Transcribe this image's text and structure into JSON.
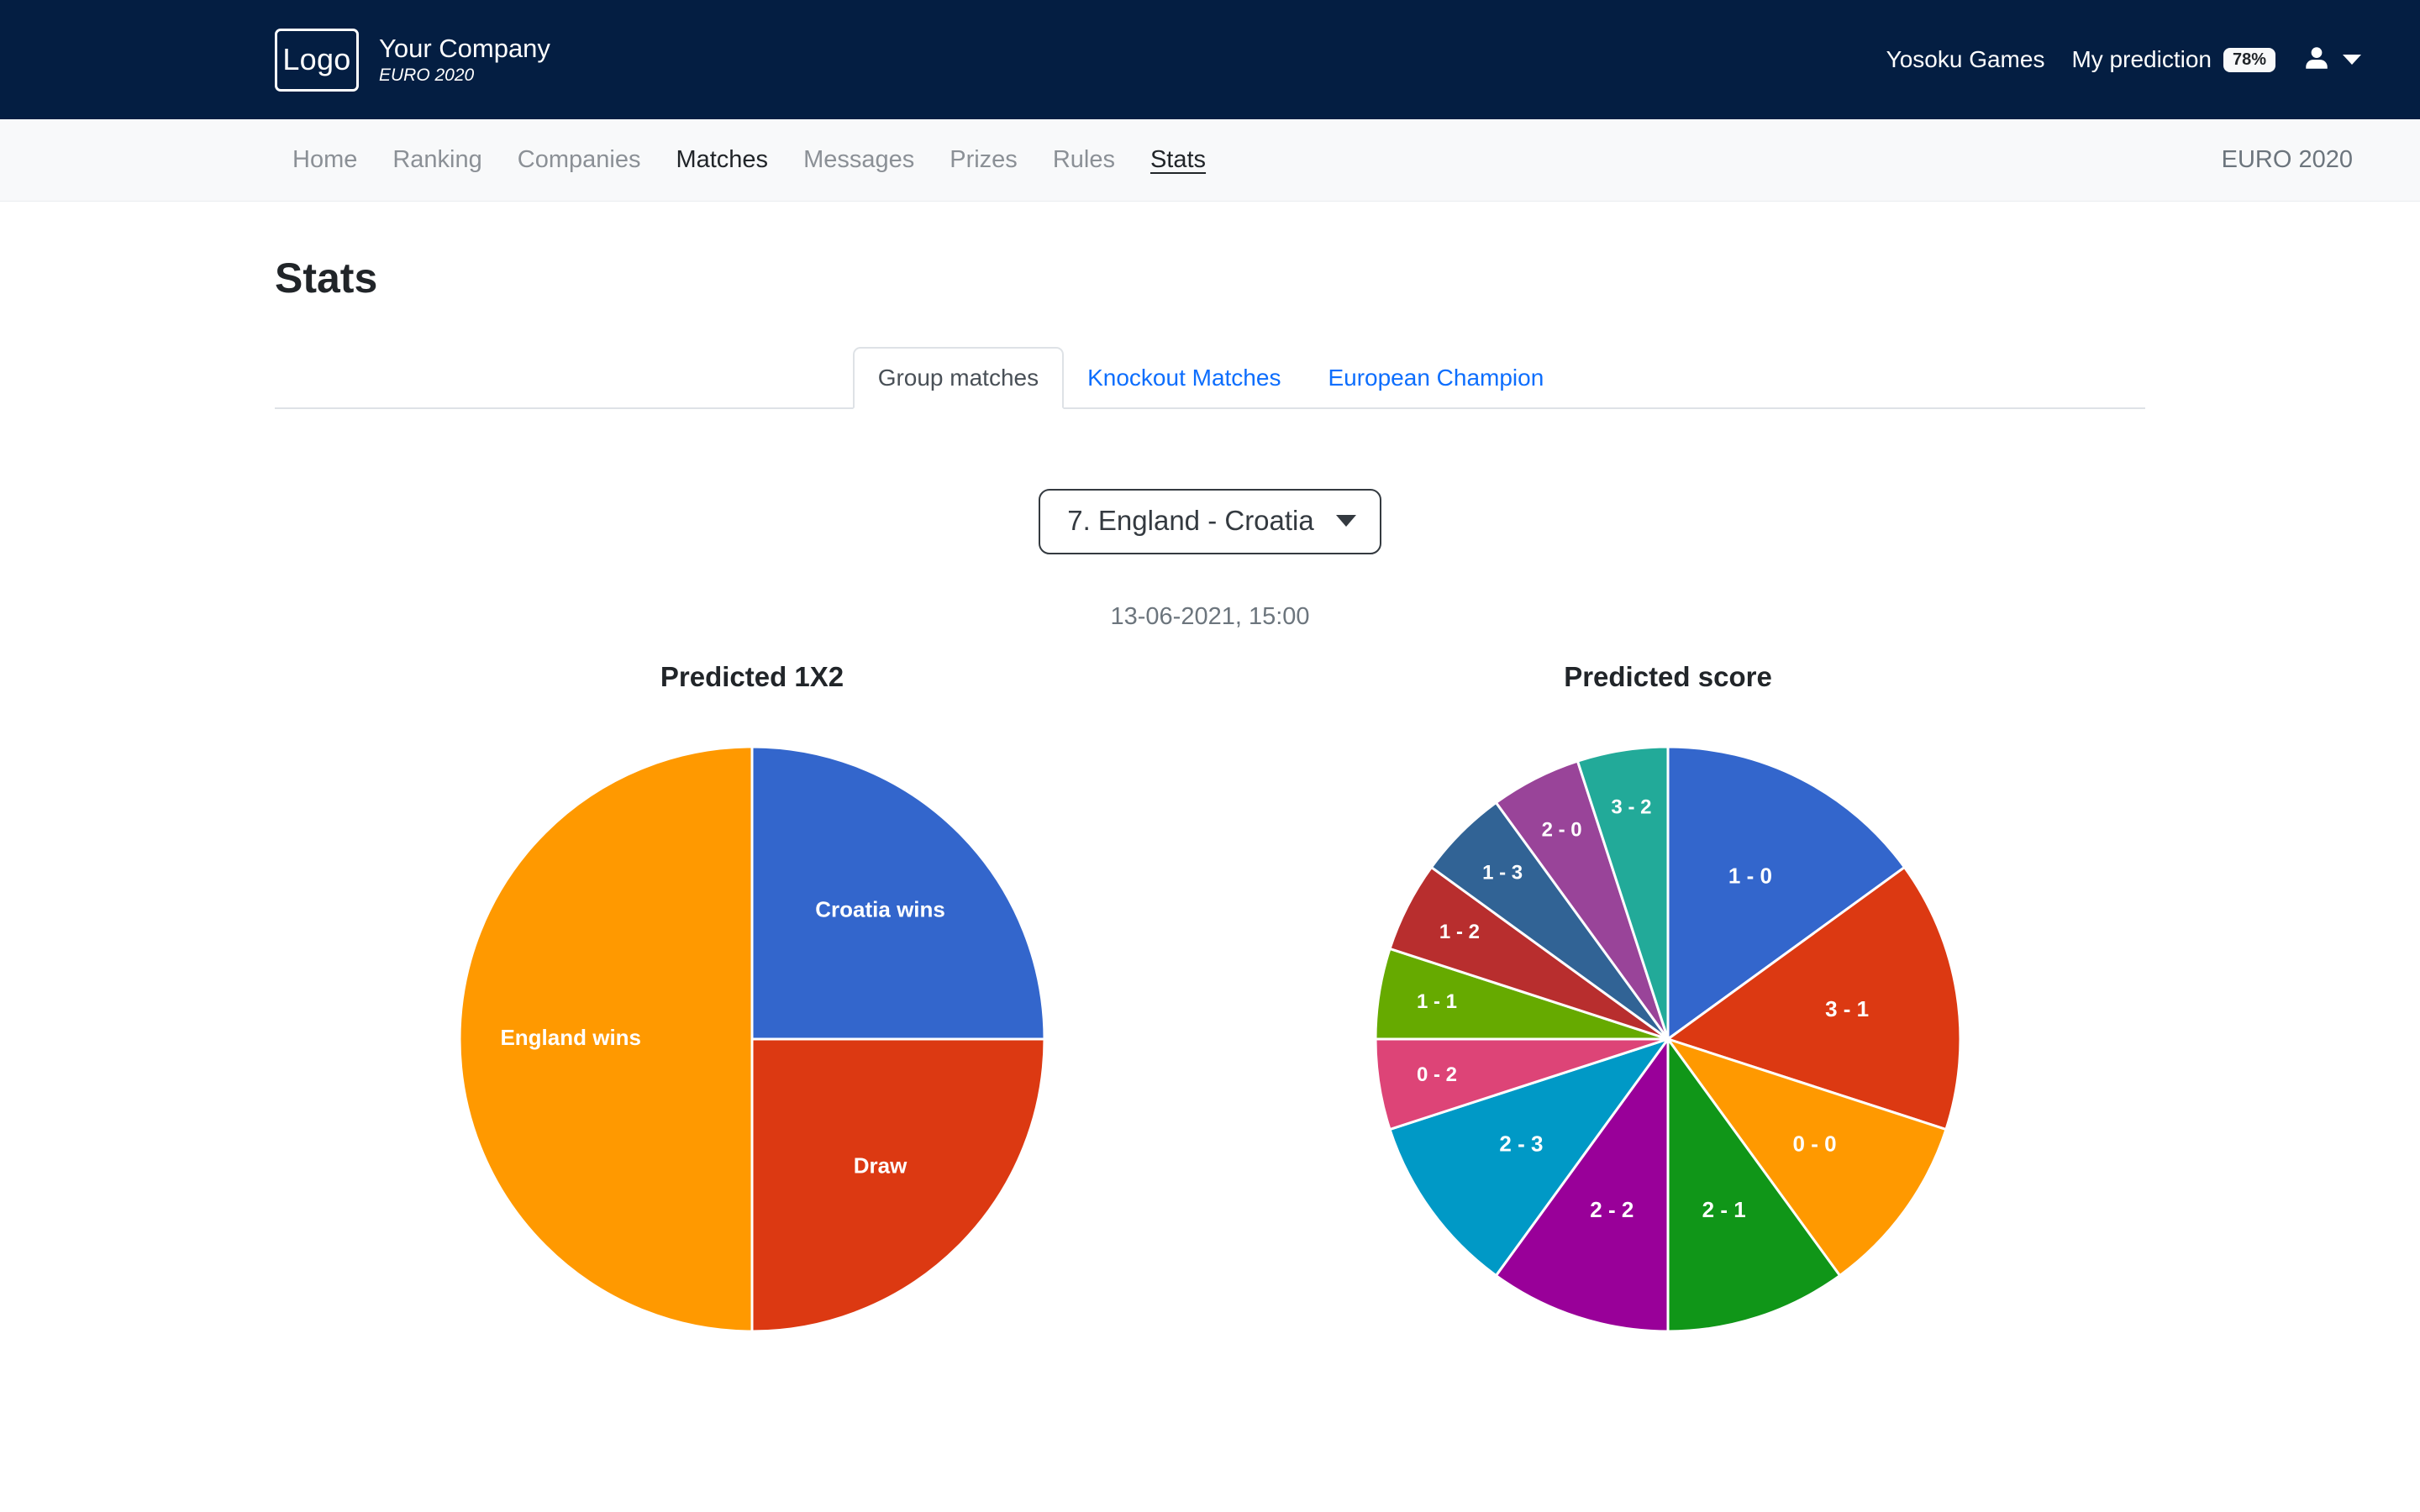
{
  "header": {
    "logo_text": "Logo",
    "company_name": "Your Company",
    "company_sub": "EURO 2020",
    "games_link": "Yosoku Games",
    "prediction_label": "My prediction",
    "prediction_badge": "78%",
    "user_icon": "person-icon",
    "caret_icon": "chevron-down-icon",
    "background_color": "#041E42"
  },
  "nav": {
    "items": [
      {
        "label": "Home",
        "state": "muted"
      },
      {
        "label": "Ranking",
        "state": "muted"
      },
      {
        "label": "Companies",
        "state": "muted"
      },
      {
        "label": "Matches",
        "state": "active"
      },
      {
        "label": "Messages",
        "state": "muted"
      },
      {
        "label": "Prizes",
        "state": "muted"
      },
      {
        "label": "Rules",
        "state": "muted"
      },
      {
        "label": "Stats",
        "state": "current"
      }
    ],
    "right_label": "EURO 2020"
  },
  "page": {
    "title": "Stats"
  },
  "tabs": [
    {
      "label": "Group matches",
      "active": true
    },
    {
      "label": "Knockout Matches",
      "active": false
    },
    {
      "label": "European Champion",
      "active": false
    }
  ],
  "match_selector": {
    "selected": "7. England - Croatia",
    "caret_icon": "caret-down-icon"
  },
  "match_date": "13-06-2021, 15:00",
  "chart_data": [
    {
      "type": "pie",
      "title": "Predicted 1X2",
      "categories": [
        "Croatia wins",
        "Draw",
        "England wins"
      ],
      "values": [
        25,
        25,
        50
      ],
      "start_angle": 0,
      "colors": [
        "#3366CC",
        "#DC3912",
        "#FF9900"
      ],
      "labels_inside": true,
      "legend": "none"
    },
    {
      "type": "pie",
      "title": "Predicted score",
      "categories": [
        "1 - 0",
        "3 - 1",
        "0 - 0",
        "2 - 1",
        "2 - 2",
        "2 - 3",
        "0 - 2",
        "1 - 1",
        "1 - 2",
        "1 - 3",
        "2 - 0",
        "3 - 2"
      ],
      "values": [
        15,
        15,
        10,
        10,
        10,
        10,
        5,
        5,
        5,
        5,
        5,
        5
      ],
      "start_angle": 0,
      "colors": [
        "#3366CC",
        "#DC3912",
        "#FF9900",
        "#109618",
        "#990099",
        "#0099C6",
        "#DD4477",
        "#66AA00",
        "#B82E2E",
        "#316395",
        "#994499",
        "#22AA99"
      ],
      "labels_inside": true,
      "legend": "none"
    }
  ]
}
